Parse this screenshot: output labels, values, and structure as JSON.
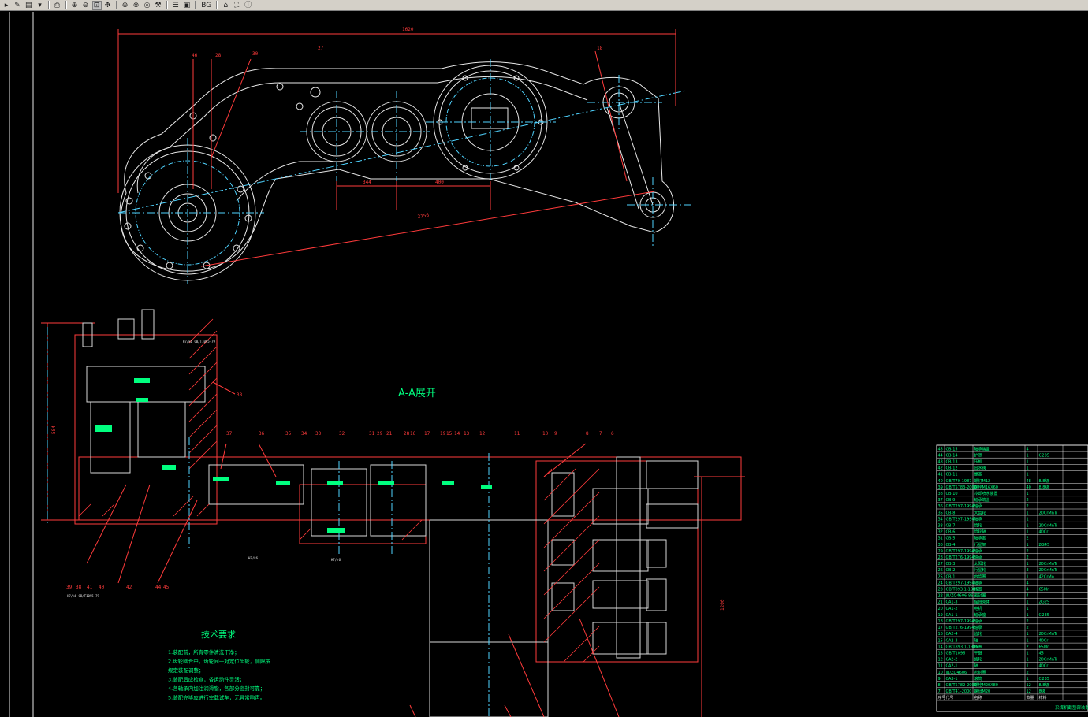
{
  "toolbar": {
    "buttons": [
      {
        "name": "open-icon",
        "glyph": "▸"
      },
      {
        "name": "tool-icon",
        "glyph": "✎"
      },
      {
        "name": "layers-icon",
        "glyph": "▤"
      },
      {
        "name": "dropdown-icon",
        "glyph": "▾"
      },
      {
        "name": "print-icon",
        "glyph": "⎙"
      },
      {
        "name": "zoom-in-icon",
        "glyph": "⊕"
      },
      {
        "name": "zoom-out-icon",
        "glyph": "⊖"
      },
      {
        "name": "zoom-window-icon",
        "glyph": "⊡",
        "pressed": true
      },
      {
        "name": "pan-icon",
        "glyph": "✥"
      },
      {
        "name": "zoom-prev-icon",
        "glyph": "⊕"
      },
      {
        "name": "zoom-all-icon",
        "glyph": "⊗"
      },
      {
        "name": "zoom-extents-icon",
        "glyph": "◎"
      },
      {
        "name": "measure-icon",
        "glyph": "⚒"
      },
      {
        "name": "layer-list-icon",
        "glyph": "☰"
      },
      {
        "name": "page-icon",
        "glyph": "▣"
      },
      {
        "name": "background-toggle",
        "glyph": "BG"
      },
      {
        "name": "home-icon",
        "glyph": "⌂"
      },
      {
        "name": "bookmark-icon",
        "glyph": "⛶"
      },
      {
        "name": "info-icon",
        "glyph": "ⓘ"
      }
    ]
  },
  "drawing": {
    "section_title": "A-A展开",
    "tech_title": "技术要求",
    "tech_lines": [
      "1.装配前，所有零件清洗干净；",
      "2.齿轮啮合中，齿轮间一对定位齿轮，侧隙按",
      "  规定装配调整；",
      "3.装配后应检查，各运动件灵活；",
      "4.各轴承内加注润滑脂，各部分密封可靠；",
      "5.装配完毕应进行空载试车，无异常响声。"
    ],
    "dims": {
      "top_overall": "1620",
      "lower_overall": "2156",
      "sub_a": "344",
      "sub_b": "400",
      "left_height": "584",
      "right_height": "1200"
    },
    "balloons_top": [
      "46",
      "28",
      "30",
      "27",
      "18"
    ],
    "balloons_section": [
      "37",
      "36",
      "35",
      "34",
      "33",
      "32",
      "31",
      "29",
      "21",
      "28",
      "16",
      "17",
      "19",
      "15",
      "14",
      "13",
      "12",
      "11",
      "10",
      "9",
      "8",
      "7",
      "6"
    ],
    "balloons_bottom": [
      "39",
      "38",
      "41",
      "40",
      "42",
      "44",
      "45"
    ],
    "callout_left": "38",
    "fit_labels": [
      "H7/k6  GB/T1095-79",
      "H7/k6  GB/T1095-79",
      "H7/k6",
      "H7/r6"
    ],
    "bom_rows": [
      [
        "45",
        "CB-15",
        "轴承端盖",
        "4",
        ""
      ],
      [
        "44",
        "CB-14",
        "护罩",
        "1",
        "Q235"
      ],
      [
        "43",
        "CB-13",
        "压板",
        "1",
        ""
      ],
      [
        "42",
        "CB-12",
        "出水阀",
        "1",
        ""
      ],
      [
        "41",
        "CB-11",
        "螺塞",
        "1",
        ""
      ],
      [
        "40",
        "GB/T70-1987",
        "螺钉M12",
        "48",
        "8.8级"
      ],
      [
        "39",
        "GB/T5783-2000",
        "螺栓M16X60",
        "40",
        "8.8级"
      ],
      [
        "38",
        "CB-10",
        "冷却喷水装置",
        "1",
        ""
      ],
      [
        "37",
        "CB-9",
        "轴承端盖",
        "2",
        ""
      ],
      [
        "36",
        "GB/T297-1994",
        "轴承",
        "2",
        ""
      ],
      [
        "35",
        "CB-8",
        "大齿轮",
        "1",
        "20CrMnTi"
      ],
      [
        "34",
        "GB/T297-1994",
        "轴承",
        "1",
        ""
      ],
      [
        "33",
        "CB-7",
        "惰轮",
        "1",
        "20CrMnTi"
      ],
      [
        "32",
        "CB-6",
        "惰轮轴",
        "1",
        "40Cr"
      ],
      [
        "31",
        "CB-5",
        "轴承套",
        "2",
        ""
      ],
      [
        "30",
        "CB-4",
        "行星架",
        "1",
        "ZG45"
      ],
      [
        "29",
        "GB/T297-1994",
        "轴承",
        "2",
        ""
      ],
      [
        "28",
        "GB/T276-1994",
        "轴承",
        "2",
        ""
      ],
      [
        "27",
        "CB-3",
        "太阳轮",
        "1",
        "20CrMnTi"
      ],
      [
        "26",
        "CB-2",
        "行星轮",
        "3",
        "20CrMnTi"
      ],
      [
        "25",
        "CB-1",
        "内齿圈",
        "1",
        "42CrMo"
      ],
      [
        "24",
        "GB/T297-1994",
        "轴承",
        "4",
        ""
      ],
      [
        "23",
        "GB/T893.1-1986",
        "挡圈",
        "4",
        "65Mn"
      ],
      [
        "22",
        "JB/ZQ4606-86",
        "密封圈",
        "4",
        ""
      ],
      [
        "21",
        "CA1-3",
        "摇臂壳体",
        "1",
        "ZG25"
      ],
      [
        "20",
        "CA1-2",
        "电机",
        "1",
        ""
      ],
      [
        "19",
        "CA1-1",
        "轴承座",
        "1",
        "Q235"
      ],
      [
        "18",
        "GB/T297-1994",
        "轴承",
        "2",
        ""
      ],
      [
        "17",
        "GB/T276-1994",
        "轴承",
        "2",
        ""
      ],
      [
        "16",
        "CA2-4",
        "齿轮",
        "1",
        "20CrMnTi"
      ],
      [
        "15",
        "CA2-3",
        "轴",
        "1",
        "40Cr"
      ],
      [
        "14",
        "GB/T893.1-1986",
        "挡圈",
        "2",
        "65Mn"
      ],
      [
        "13",
        "GB/T1096",
        "平键",
        "1",
        "45"
      ],
      [
        "12",
        "CA2-2",
        "齿轮",
        "1",
        "20CrMnTi"
      ],
      [
        "11",
        "CA2-1",
        "轴",
        "1",
        "40Cr"
      ],
      [
        "10",
        "JB/ZQ4606",
        "密封圈",
        "2",
        ""
      ],
      [
        "9",
        "CA3-1",
        "滚筒",
        "1",
        "Q235"
      ],
      [
        "8",
        "GB/T5782-2000",
        "螺栓M20X80",
        "12",
        "8.8级"
      ],
      [
        "7",
        "GB/T41-2000",
        "螺母M20",
        "12",
        "8级"
      ]
    ],
    "bom_footer": [
      "序号",
      "代号",
      "名称",
      "数量",
      "材料"
    ],
    "bom_title": "采煤机截割部装配图"
  }
}
